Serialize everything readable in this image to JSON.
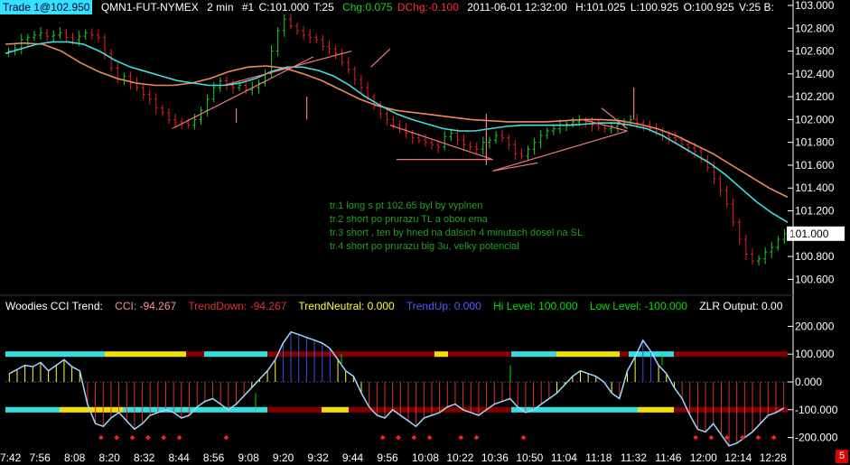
{
  "header": {
    "trade_badge": "Trade 1@102.950",
    "symbol": "QMN1-FUT-NYMEX",
    "interval": "2 min",
    "bar_num": "#1",
    "close": "C:101.000",
    "ticks": "T:25",
    "change": "Chg:0.075",
    "dchange": "DChg:-0.100",
    "datetime": "2011-06-01 12:32:00",
    "high": "H:101.025",
    "low": "L:100.925",
    "open": "O:100.925",
    "volume": "V:25 B:"
  },
  "notes": [
    "tr.1 long s pt 102.65 byl by vyplnen",
    "tr.2 short po prurazu TL a obou ema",
    "tr.3 short , ten by hned na dalsich 4 minutach dosel na SL",
    "tr.4 short po prurazu big 3u, velky potencial"
  ],
  "indicator_header": {
    "title": "Woodies CCI Trend:",
    "cci": "CCI: -94.267",
    "trend_down": "TrendDown: -94.267",
    "trend_neutral": "TrendNeutral: 0.000",
    "trend_up": "TrendUp: 0.000",
    "hi_level": "Hi Level: 100.000",
    "low_level": "Low Level: -100.000",
    "zlr": "ZLR Output: 0.00"
  },
  "last_price_label": "101.000",
  "page_number": "5",
  "colors": {
    "background": "#000000",
    "bar_up": "#1fd01f",
    "bar_down": "#e02020",
    "ema_fast": "#40e0e0",
    "ema_slow": "#f08a5a",
    "trendline": "#f07a7a",
    "cci_line": "#9fd8ff",
    "trend_down": "#e03030",
    "trend_neutral": "#ffff40",
    "trend_up": "#3a4de0",
    "hi_level": "#00e000",
    "low_level": "#00e000",
    "band_dark": "#800000",
    "band_cyan": "#30e0e0",
    "band_yellow": "#f0e000"
  },
  "chart_data": [
    {
      "type": "line",
      "title": "QMN1-FUT-NYMEX 2 min",
      "y_axis_ticks": [
        "103.000",
        "102.800",
        "102.600",
        "102.400",
        "102.200",
        "102.000",
        "101.800",
        "101.600",
        "101.400",
        "101.200",
        "101.000",
        "100.800",
        "100.600"
      ],
      "ylim": [
        100.5,
        103.0
      ],
      "time_ticks": [
        "7:42",
        "7:56",
        "8:08",
        "8:20",
        "8:32",
        "8:44",
        "8:56",
        "9:08",
        "9:20",
        "9:32",
        "9:44",
        "9:56",
        "10:08",
        "10:22",
        "10:36",
        "10:50",
        "11:04",
        "11:18",
        "11:32",
        "11:46",
        "12:00",
        "12:14",
        "12:28"
      ],
      "series": [
        {
          "name": "price",
          "values": [
            102.6,
            102.62,
            102.7,
            102.72,
            102.74,
            102.76,
            102.73,
            102.74,
            102.76,
            102.72,
            102.7,
            102.73,
            102.76,
            102.74,
            102.72,
            102.58,
            102.45,
            102.35,
            102.38,
            102.32,
            102.28,
            102.22,
            102.18,
            102.1,
            102.06,
            102.0,
            101.98,
            101.97,
            101.95,
            102.0,
            102.08,
            102.18,
            102.28,
            102.34,
            102.3,
            102.28,
            102.3,
            102.26,
            102.28,
            102.32,
            102.4,
            102.6,
            102.78,
            102.88,
            102.82,
            102.78,
            102.74,
            102.72,
            102.7,
            102.64,
            102.62,
            102.58,
            102.5,
            102.44,
            102.35,
            102.28,
            102.2,
            102.12,
            102.05,
            102.0,
            101.95,
            101.92,
            101.88,
            101.84,
            101.82,
            101.8,
            101.78,
            101.76,
            101.85,
            101.88,
            101.82,
            101.78,
            101.76,
            101.74,
            101.8,
            101.82,
            101.86,
            101.84,
            101.78,
            101.7,
            101.68,
            101.74,
            101.8,
            101.86,
            101.9,
            101.92,
            101.95,
            101.96,
            101.98,
            101.99,
            101.98,
            101.95,
            101.93,
            101.92,
            101.94,
            101.96,
            101.98,
            102.0,
            101.97,
            101.95,
            101.92,
            101.9,
            101.86,
            101.84,
            101.82,
            101.78,
            101.75,
            101.72,
            101.65,
            101.58,
            101.48,
            101.38,
            101.26,
            101.1,
            100.95,
            100.82,
            100.76,
            100.78,
            100.84,
            100.88,
            100.95,
            101.0
          ],
          "ohlc_note": "approximate close path read from candles"
        },
        {
          "name": "ema_fast",
          "values": [
            102.58,
            102.62,
            102.66,
            102.68,
            102.68,
            102.66,
            102.6,
            102.52,
            102.46,
            102.42,
            102.38,
            102.34,
            102.32,
            102.3,
            102.3,
            102.32,
            102.36,
            102.42,
            102.46,
            102.46,
            102.43,
            102.38,
            102.3,
            102.2,
            102.12,
            102.05,
            102.0,
            101.96,
            101.92,
            101.9,
            101.9,
            101.92,
            101.94,
            101.95,
            101.95,
            101.95,
            101.95,
            101.96,
            101.97,
            101.97,
            101.95,
            101.92,
            101.86,
            101.78,
            101.7,
            101.62,
            101.52,
            101.4,
            101.28,
            101.18,
            101.1
          ]
        },
        {
          "name": "ema_slow",
          "values": [
            102.66,
            102.67,
            102.66,
            102.6,
            102.5,
            102.42,
            102.36,
            102.32,
            102.3,
            102.3,
            102.32,
            102.36,
            102.42,
            102.46,
            102.47,
            102.45,
            102.4,
            102.34,
            102.26,
            102.18,
            102.12,
            102.08,
            102.06,
            102.04,
            102.02,
            102.0,
            101.99,
            101.98,
            101.98,
            101.98,
            101.99,
            102.0,
            102.0,
            101.99,
            101.96,
            101.92,
            101.86,
            101.78,
            101.7,
            101.6,
            101.5,
            101.4,
            101.32
          ]
        }
      ]
    },
    {
      "type": "line",
      "title": "Woodies CCI Trend",
      "y_axis_ticks": [
        "200.000",
        "100.000",
        "0.000",
        "-100.000",
        "-200.000"
      ],
      "ylim": [
        -250,
        250
      ],
      "series": [
        {
          "name": "CCI",
          "values": [
            30,
            45,
            60,
            55,
            70,
            40,
            60,
            80,
            55,
            40,
            -80,
            -150,
            -160,
            -130,
            -110,
            -140,
            -170,
            -150,
            -120,
            -110,
            -100,
            -110,
            -130,
            -120,
            -90,
            -70,
            -60,
            -80,
            -100,
            -80,
            -50,
            -20,
            10,
            40,
            80,
            140,
            180,
            170,
            160,
            150,
            140,
            120,
            80,
            40,
            20,
            -40,
            -90,
            -120,
            -130,
            -100,
            -120,
            -140,
            -160,
            -130,
            -120,
            -110,
            -90,
            -80,
            -100,
            -110,
            -120,
            -100,
            -80,
            -70,
            -60,
            -90,
            -110,
            -100,
            -80,
            -60,
            -40,
            -10,
            20,
            40,
            30,
            20,
            0,
            -40,
            -60,
            40,
            90,
            150,
            110,
            60,
            30,
            -20,
            -60,
            -120,
            -170,
            -180,
            -150,
            -190,
            -230,
            -220,
            -200,
            -180,
            -150,
            -120,
            -110,
            -94
          ]
        }
      ]
    }
  ]
}
